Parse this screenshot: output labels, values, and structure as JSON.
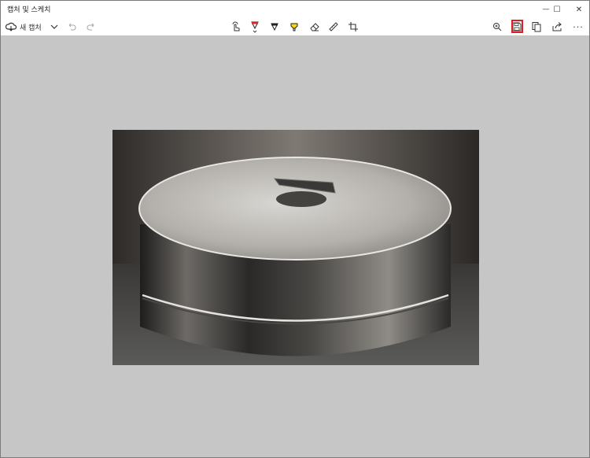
{
  "window": {
    "title": "캡처 및 스케치"
  },
  "window_controls": {
    "minimize": "—",
    "maximize": "☐",
    "close": "✕"
  },
  "toolbar": {
    "new_capture_label": "새 캡처",
    "more_label": "···",
    "icons": [
      "new-capture-icon",
      "dropdown-icon",
      "undo-icon",
      "redo-icon",
      "touch-writing-icon",
      "ballpoint-pen-icon",
      "pencil-icon",
      "highlighter-icon",
      "eraser-icon",
      "ruler-icon",
      "crop-icon",
      "zoom-icon",
      "save-icon",
      "copy-icon",
      "share-icon",
      "more-icon"
    ],
    "pen_color": "#d62828",
    "highlighter_color": "#f5d90a",
    "highlight_color": "#e02020"
  },
  "canvas": {
    "background": "#c6c6c6"
  },
  "image": {
    "subject": "thin graphite flake levitating above a stacked cylindrical magnet"
  }
}
